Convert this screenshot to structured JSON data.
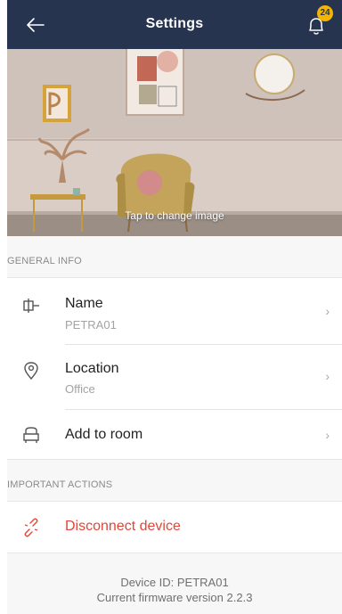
{
  "header": {
    "title": "Settings",
    "back_icon": "arrow-left-icon",
    "notification_icon": "bell-icon",
    "notification_count": "24",
    "bg_color": "#27344f",
    "badge_color": "#f4b400"
  },
  "hero": {
    "caption": "Tap to change image"
  },
  "general_info": {
    "title": "GENERAL INFO",
    "items": [
      {
        "label": "Name",
        "value": "PETRA01",
        "icon": "device-plug-icon"
      },
      {
        "label": "Location",
        "value": "Office",
        "icon": "location-pin-icon"
      },
      {
        "label": "Add to room",
        "icon": "armchair-icon"
      }
    ]
  },
  "important_actions": {
    "title": "IMPORTANT ACTIONS",
    "items": [
      {
        "label": "Disconnect device",
        "icon": "broken-link-icon",
        "color": "#e0463a"
      }
    ]
  },
  "footer": {
    "device_id": "Device ID: PETRA01",
    "firmware": "Current firmware version 2.2.3"
  }
}
